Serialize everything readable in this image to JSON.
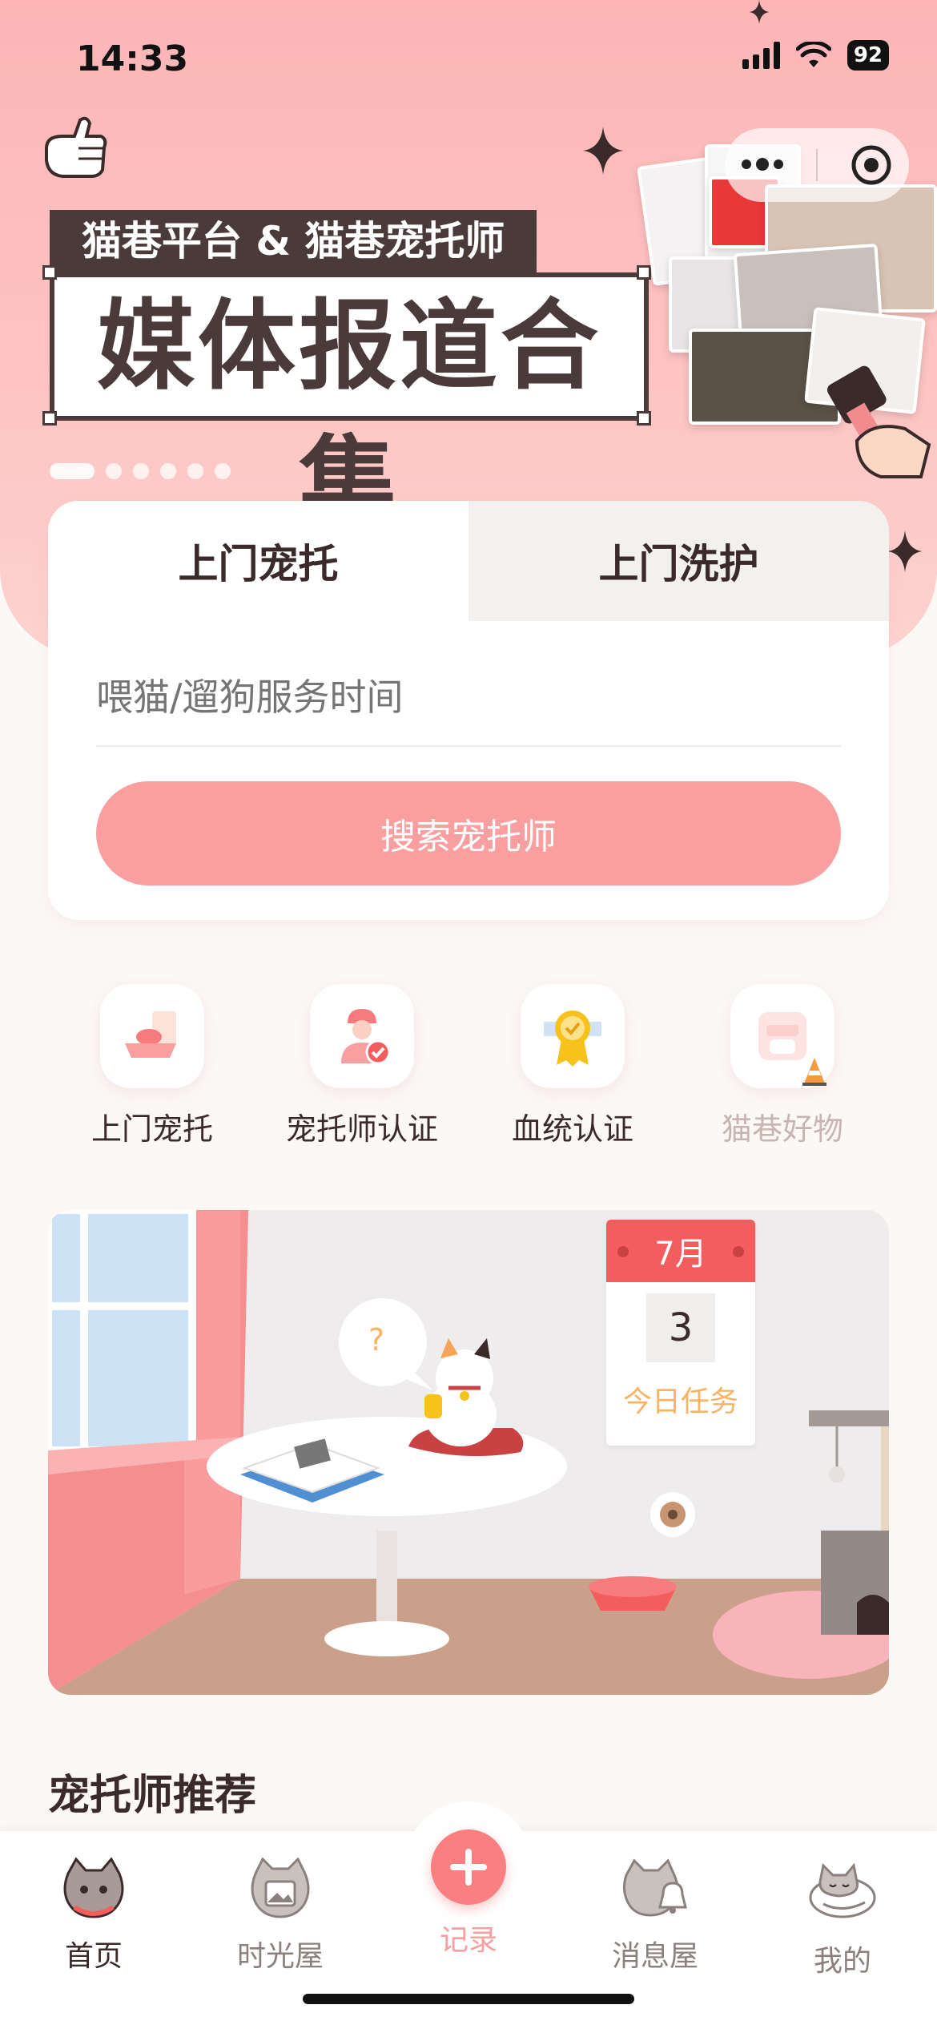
{
  "status_bar": {
    "time": "14:33",
    "battery": "92"
  },
  "banner": {
    "subtitle": "猫巷平台 & 猫巷宠托师",
    "title": "媒体报道合集",
    "slide_count": 6,
    "active_slide": 1
  },
  "search_card": {
    "tabs": [
      {
        "label": "上门宠托",
        "active": true
      },
      {
        "label": "上门洗护",
        "active": false
      }
    ],
    "time_placeholder": "喂猫/遛狗服务时间",
    "search_button": "搜索宠托师"
  },
  "quick_entries": [
    {
      "label": "上门宠托",
      "icon": "pet-bowl-icon",
      "enabled": true
    },
    {
      "label": "宠托师认证",
      "icon": "verified-sitter-icon",
      "enabled": true
    },
    {
      "label": "血统认证",
      "icon": "award-badge-icon",
      "enabled": true
    },
    {
      "label": "猫巷好物",
      "icon": "shop-bag-icon",
      "enabled": false
    }
  ],
  "daily_scene": {
    "calendar_month": "7月",
    "calendar_count": "3",
    "calendar_task": "今日任务",
    "bubble": "?"
  },
  "recommend": {
    "title": "宠托师推荐"
  },
  "tabbar": {
    "items": [
      {
        "label": "首页",
        "icon": "cat-home-icon",
        "active": true
      },
      {
        "label": "时光屋",
        "icon": "cat-photo-icon",
        "active": false
      },
      {
        "label": "记录",
        "icon": "plus-icon",
        "active": false
      },
      {
        "label": "消息屋",
        "icon": "cat-bell-icon",
        "active": false
      },
      {
        "label": "我的",
        "icon": "cat-sleep-icon",
        "active": false
      }
    ]
  },
  "colors": {
    "brand_pink": "#f99f9f",
    "accent_red": "#f45d5e",
    "text_dark": "#3b2a2a",
    "header_pink": "#fdb5b6"
  }
}
